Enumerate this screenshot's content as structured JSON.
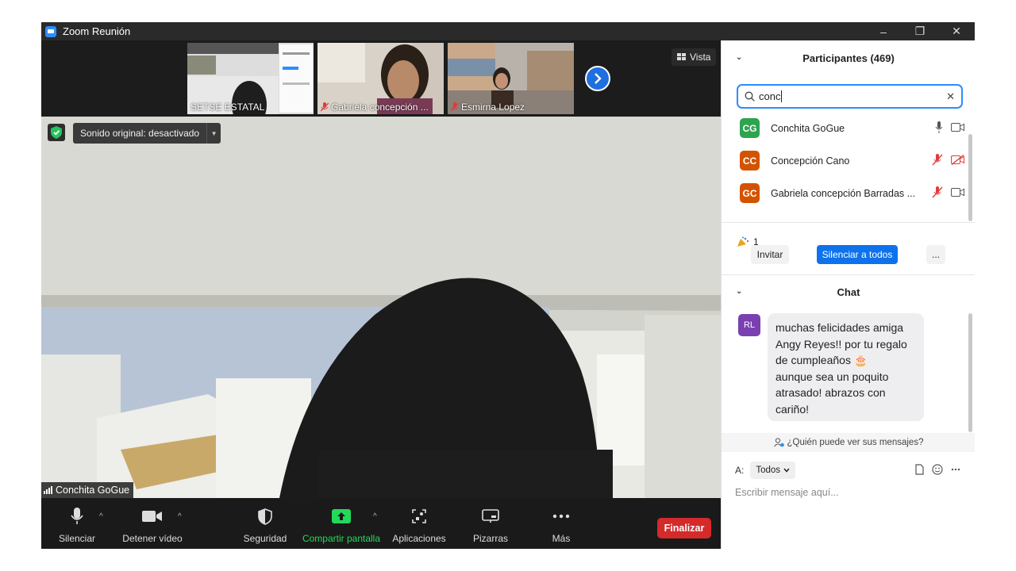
{
  "window": {
    "title": "Zoom Reunión",
    "controls": [
      "–",
      "❐",
      "✕"
    ]
  },
  "strip": {
    "thumbnails": [
      {
        "label": "SETSE ESTATAL",
        "muted": false
      },
      {
        "label": "Gabriela concepción ...",
        "muted": true
      },
      {
        "label": "Esmirna Lopez",
        "muted": true
      }
    ],
    "view_label": "Vista"
  },
  "main_video": {
    "sound_label": "Sonido original: desactivado",
    "speaker_name": "Conchita GoGue"
  },
  "toolbar": {
    "mute_label": "Silenciar",
    "video_label": "Detener vídeo",
    "security_label": "Seguridad",
    "share_label": "Compartir pantalla",
    "apps_label": "Aplicaciones",
    "whiteboards_label": "Pizarras",
    "more_label": "Más",
    "end_label": "Finalizar",
    "share_color": "#23d959"
  },
  "participants": {
    "title": "Participantes (469)",
    "search_value": "conc",
    "items": [
      {
        "initials": "CG",
        "name": "Conchita GoGue",
        "color": "#2ea44f",
        "mic_muted": false,
        "video_off": false
      },
      {
        "initials": "CC",
        "name": "Concepción Cano",
        "color": "#d35400",
        "mic_muted": true,
        "video_off": true
      },
      {
        "initials": "GC",
        "name": "Gabriela concepción Barradas ...",
        "color": "#d35400",
        "mic_muted": true,
        "video_off": false
      }
    ],
    "reaction_count": "1",
    "invite_label": "Invitar",
    "mute_all_label": "Silenciar a todos",
    "more_label": "..."
  },
  "chat": {
    "title": "Chat",
    "sender_initials": "RL",
    "message_lines": [
      "muchas felicidades amiga",
      "Angy Reyes!! por tu regalo",
      "de cumpleaños 🎂",
      "aunque sea un poquito",
      "atrasado! abrazos con",
      "cariño!"
    ],
    "who_sees": "¿Quién puede ver sus mensajes?",
    "to_label": "A:",
    "recipient": "Todos",
    "input_placeholder": "Escribir mensaje aquí..."
  }
}
